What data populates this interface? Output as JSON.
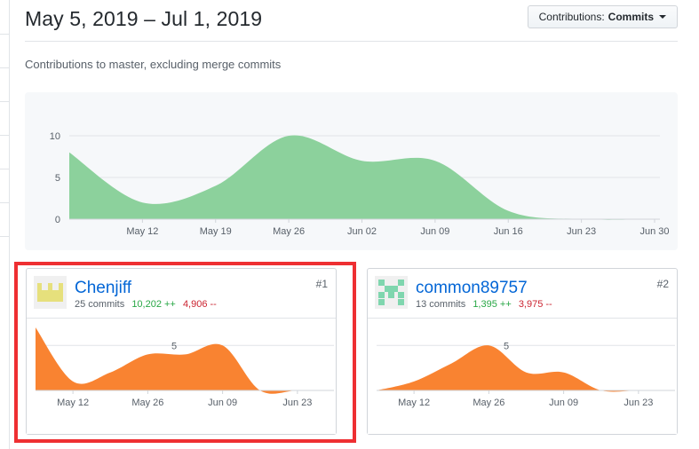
{
  "header": {
    "title": "May 5, 2019 – Jul 1, 2019",
    "contributions_button": {
      "prefix": "Contributions:",
      "value": "Commits"
    }
  },
  "subtitle": "Contributions to master, excluding merge commits",
  "colors": {
    "main_area": "#8cd19c",
    "user_area": "#f98331",
    "highlight": "#ee2f32",
    "link": "#0366d6",
    "additions": "#28a745",
    "deletions": "#cb2431"
  },
  "chart_data": [
    {
      "type": "area",
      "title": "",
      "x": [
        "May 5",
        "May 12",
        "May 19",
        "May 26",
        "Jun 02",
        "Jun 09",
        "Jun 16",
        "Jun 23",
        "Jun 30"
      ],
      "values": [
        8,
        2,
        4,
        10,
        7,
        7,
        1,
        0,
        0
      ],
      "tick_labels": [
        "May 12",
        "May 19",
        "May 26",
        "Jun 02",
        "Jun 09",
        "Jun 16",
        "Jun 23",
        "Jun 30"
      ],
      "y_ticks": [
        0,
        5,
        10
      ],
      "ylim": [
        0,
        10
      ],
      "grid": true
    },
    {
      "type": "area",
      "title": "Chenjiff",
      "x": [
        "May 5",
        "May 12",
        "May 19",
        "May 26",
        "Jun 02",
        "Jun 09",
        "Jun 16",
        "Jun 23",
        "Jun 30"
      ],
      "values": [
        7,
        1,
        2,
        4,
        4,
        5,
        0,
        0,
        0
      ],
      "tick_labels": [
        "May 12",
        "May 26",
        "Jun 09",
        "Jun 23"
      ],
      "y_ticks": [
        5
      ],
      "ylim": [
        0,
        7
      ]
    },
    {
      "type": "area",
      "title": "common89757",
      "x": [
        "May 5",
        "May 12",
        "May 19",
        "May 26",
        "Jun 02",
        "Jun 09",
        "Jun 16",
        "Jun 23",
        "Jun 30"
      ],
      "values": [
        0,
        1,
        3,
        5,
        2,
        2,
        0,
        0,
        0
      ],
      "tick_labels": [
        "May 12",
        "May 26",
        "Jun 09",
        "Jun 23"
      ],
      "y_ticks": [
        5
      ],
      "ylim": [
        0,
        7
      ]
    }
  ],
  "contributors": [
    {
      "name": "Chenjiff",
      "commits": "25 commits",
      "additions": "10,202 ++",
      "deletions": "4,906 --",
      "rank": "#1"
    },
    {
      "name": "common89757",
      "commits": "13 commits",
      "additions": "1,395 ++",
      "deletions": "3,975 --",
      "rank": "#2"
    }
  ]
}
